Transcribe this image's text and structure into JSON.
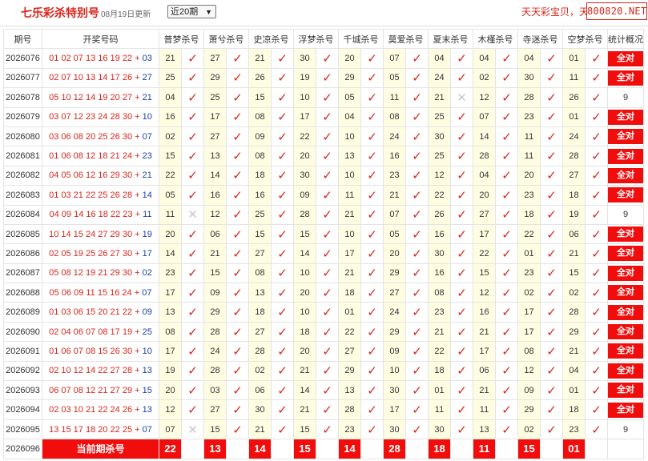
{
  "header": {
    "title": "七乐彩杀特别号",
    "date": "08月19日更新",
    "period_select": "近20期",
    "marquee": "天天彩宝贝，天天",
    "logo": "800820.NET"
  },
  "table": {
    "col_issue": "期号",
    "col_numbers": "开奖号码",
    "col_stats": "统计概况",
    "experts": [
      "普梦杀号",
      "萧兮杀号",
      "史凉杀号",
      "浮梦杀号",
      "千城杀号",
      "莫爱杀号",
      "夏末杀号",
      "木槿杀号",
      "寺迷杀号",
      "空梦杀号"
    ],
    "rows": [
      {
        "issue": "2026076",
        "numbers": "01 02 07 13 16 19 22",
        "special": "03",
        "kills": [
          "21",
          "27",
          "21",
          "30",
          "20",
          "07",
          "04",
          "04",
          "04",
          "01"
        ],
        "marks": [
          1,
          1,
          1,
          1,
          1,
          1,
          1,
          1,
          1,
          1
        ],
        "stat": "全对"
      },
      {
        "issue": "2026077",
        "numbers": "02 07 10 13 14 17 26",
        "special": "27",
        "kills": [
          "25",
          "29",
          "26",
          "19",
          "29",
          "05",
          "24",
          "02",
          "30",
          "11"
        ],
        "marks": [
          1,
          1,
          1,
          1,
          1,
          1,
          1,
          1,
          1,
          1
        ],
        "stat": "全对"
      },
      {
        "issue": "2026078",
        "numbers": "05 10 12 14 19 20 27",
        "special": "21",
        "kills": [
          "04",
          "25",
          "15",
          "10",
          "05",
          "11",
          "21",
          "12",
          "28",
          "26"
        ],
        "marks": [
          1,
          1,
          1,
          1,
          1,
          1,
          0,
          1,
          1,
          1
        ],
        "stat": "9"
      },
      {
        "issue": "2026079",
        "numbers": "03 07 12 23 24 28 30",
        "special": "10",
        "kills": [
          "16",
          "17",
          "08",
          "17",
          "04",
          "08",
          "25",
          "07",
          "23",
          "01"
        ],
        "marks": [
          1,
          1,
          1,
          1,
          1,
          1,
          1,
          1,
          1,
          1
        ],
        "stat": "全对"
      },
      {
        "issue": "2026080",
        "numbers": "03 06 08 20 25 26 30",
        "special": "07",
        "kills": [
          "02",
          "27",
          "09",
          "22",
          "10",
          "24",
          "30",
          "14",
          "11",
          "24"
        ],
        "marks": [
          1,
          1,
          1,
          1,
          1,
          1,
          1,
          1,
          1,
          1
        ],
        "stat": "全对"
      },
      {
        "issue": "2026081",
        "numbers": "01 06 08 12 18 21 24",
        "special": "23",
        "kills": [
          "15",
          "13",
          "08",
          "20",
          "13",
          "16",
          "25",
          "28",
          "11",
          "28"
        ],
        "marks": [
          1,
          1,
          1,
          1,
          1,
          1,
          1,
          1,
          1,
          1
        ],
        "stat": "全对"
      },
      {
        "issue": "2026082",
        "numbers": "04 05 06 12 16 29 30",
        "special": "21",
        "kills": [
          "22",
          "14",
          "18",
          "30",
          "10",
          "23",
          "12",
          "04",
          "20",
          "27"
        ],
        "marks": [
          1,
          1,
          1,
          1,
          1,
          1,
          1,
          1,
          1,
          1
        ],
        "stat": "全对"
      },
      {
        "issue": "2026083",
        "numbers": "01 03 21 22 25 26 28",
        "special": "14",
        "kills": [
          "05",
          "16",
          "16",
          "09",
          "11",
          "21",
          "22",
          "20",
          "23",
          "18"
        ],
        "marks": [
          1,
          1,
          1,
          1,
          1,
          1,
          1,
          1,
          1,
          1
        ],
        "stat": "全对"
      },
      {
        "issue": "2026084",
        "numbers": "04 09 14 16 18 22 23",
        "special": "11",
        "kills": [
          "11",
          "12",
          "25",
          "28",
          "21",
          "07",
          "26",
          "27",
          "18",
          "19"
        ],
        "marks": [
          0,
          1,
          1,
          1,
          1,
          1,
          1,
          1,
          1,
          1
        ],
        "stat": "9"
      },
      {
        "issue": "2026085",
        "numbers": "10 14 15 24 27 29 30",
        "special": "19",
        "kills": [
          "20",
          "06",
          "15",
          "15",
          "10",
          "05",
          "16",
          "17",
          "22",
          "06"
        ],
        "marks": [
          1,
          1,
          1,
          1,
          1,
          1,
          1,
          1,
          1,
          1
        ],
        "stat": "全对"
      },
      {
        "issue": "2026086",
        "numbers": "02 05 19 25 26 27 30",
        "special": "17",
        "kills": [
          "14",
          "21",
          "27",
          "14",
          "17",
          "20",
          "30",
          "22",
          "01",
          "21"
        ],
        "marks": [
          1,
          1,
          1,
          1,
          1,
          1,
          1,
          1,
          1,
          1
        ],
        "stat": "全对"
      },
      {
        "issue": "2026087",
        "numbers": "05 08 12 19 21 29 30",
        "special": "02",
        "kills": [
          "23",
          "15",
          "08",
          "10",
          "21",
          "29",
          "16",
          "15",
          "23",
          "15"
        ],
        "marks": [
          1,
          1,
          1,
          1,
          1,
          1,
          1,
          1,
          1,
          1
        ],
        "stat": "全对"
      },
      {
        "issue": "2026088",
        "numbers": "05 06 09 11 15 16 24",
        "special": "07",
        "kills": [
          "17",
          "09",
          "13",
          "20",
          "18",
          "27",
          "08",
          "12",
          "02",
          "02"
        ],
        "marks": [
          1,
          1,
          1,
          1,
          1,
          1,
          1,
          1,
          1,
          1
        ],
        "stat": "全对"
      },
      {
        "issue": "2026089",
        "numbers": "01 03 06 15 20 21 22",
        "special": "09",
        "kills": [
          "13",
          "29",
          "18",
          "10",
          "01",
          "24",
          "23",
          "16",
          "17",
          "28"
        ],
        "marks": [
          1,
          1,
          1,
          1,
          1,
          1,
          1,
          1,
          1,
          1
        ],
        "stat": "全对"
      },
      {
        "issue": "2026090",
        "numbers": "02 04 06 07 08 17 19",
        "special": "25",
        "kills": [
          "08",
          "28",
          "27",
          "18",
          "22",
          "29",
          "21",
          "21",
          "17",
          "29"
        ],
        "marks": [
          1,
          1,
          1,
          1,
          1,
          1,
          1,
          1,
          1,
          1
        ],
        "stat": "全对"
      },
      {
        "issue": "2026091",
        "numbers": "01 06 07 08 15 26 30",
        "special": "10",
        "kills": [
          "17",
          "24",
          "28",
          "20",
          "27",
          "09",
          "22",
          "17",
          "08",
          "21"
        ],
        "marks": [
          1,
          1,
          1,
          1,
          1,
          1,
          1,
          1,
          1,
          1
        ],
        "stat": "全对"
      },
      {
        "issue": "2026092",
        "numbers": "02 10 12 14 22 27 28",
        "special": "13",
        "kills": [
          "19",
          "28",
          "02",
          "21",
          "29",
          "10",
          "18",
          "06",
          "12",
          "04"
        ],
        "marks": [
          1,
          1,
          1,
          1,
          1,
          1,
          1,
          1,
          1,
          1
        ],
        "stat": "全对"
      },
      {
        "issue": "2026093",
        "numbers": "06 07 08 12 21 27 29",
        "special": "15",
        "kills": [
          "20",
          "03",
          "06",
          "14",
          "13",
          "30",
          "01",
          "21",
          "09",
          "01"
        ],
        "marks": [
          1,
          1,
          1,
          1,
          1,
          1,
          1,
          1,
          1,
          1
        ],
        "stat": "全对"
      },
      {
        "issue": "2026094",
        "numbers": "02 03 10 21 22 24 26",
        "special": "13",
        "kills": [
          "12",
          "27",
          "30",
          "21",
          "28",
          "17",
          "11",
          "11",
          "29",
          "18"
        ],
        "marks": [
          1,
          1,
          1,
          1,
          1,
          1,
          1,
          1,
          1,
          1
        ],
        "stat": "全对"
      },
      {
        "issue": "2026095",
        "numbers": "13 15 17 18 20 22 25",
        "special": "07",
        "kills": [
          "07",
          "15",
          "21",
          "15",
          "23",
          "30",
          "30",
          "13",
          "02",
          "23"
        ],
        "marks": [
          0,
          1,
          1,
          1,
          1,
          1,
          1,
          1,
          1,
          1
        ],
        "stat": "9"
      }
    ],
    "current": {
      "issue": "2026096",
      "label": "当前期杀号",
      "kills": [
        "22",
        "13",
        "14",
        "15",
        "14",
        "28",
        "18",
        "11",
        "15",
        "01"
      ]
    },
    "check_symbol": "✓",
    "cross_symbol": "✕",
    "plus": "+"
  }
}
